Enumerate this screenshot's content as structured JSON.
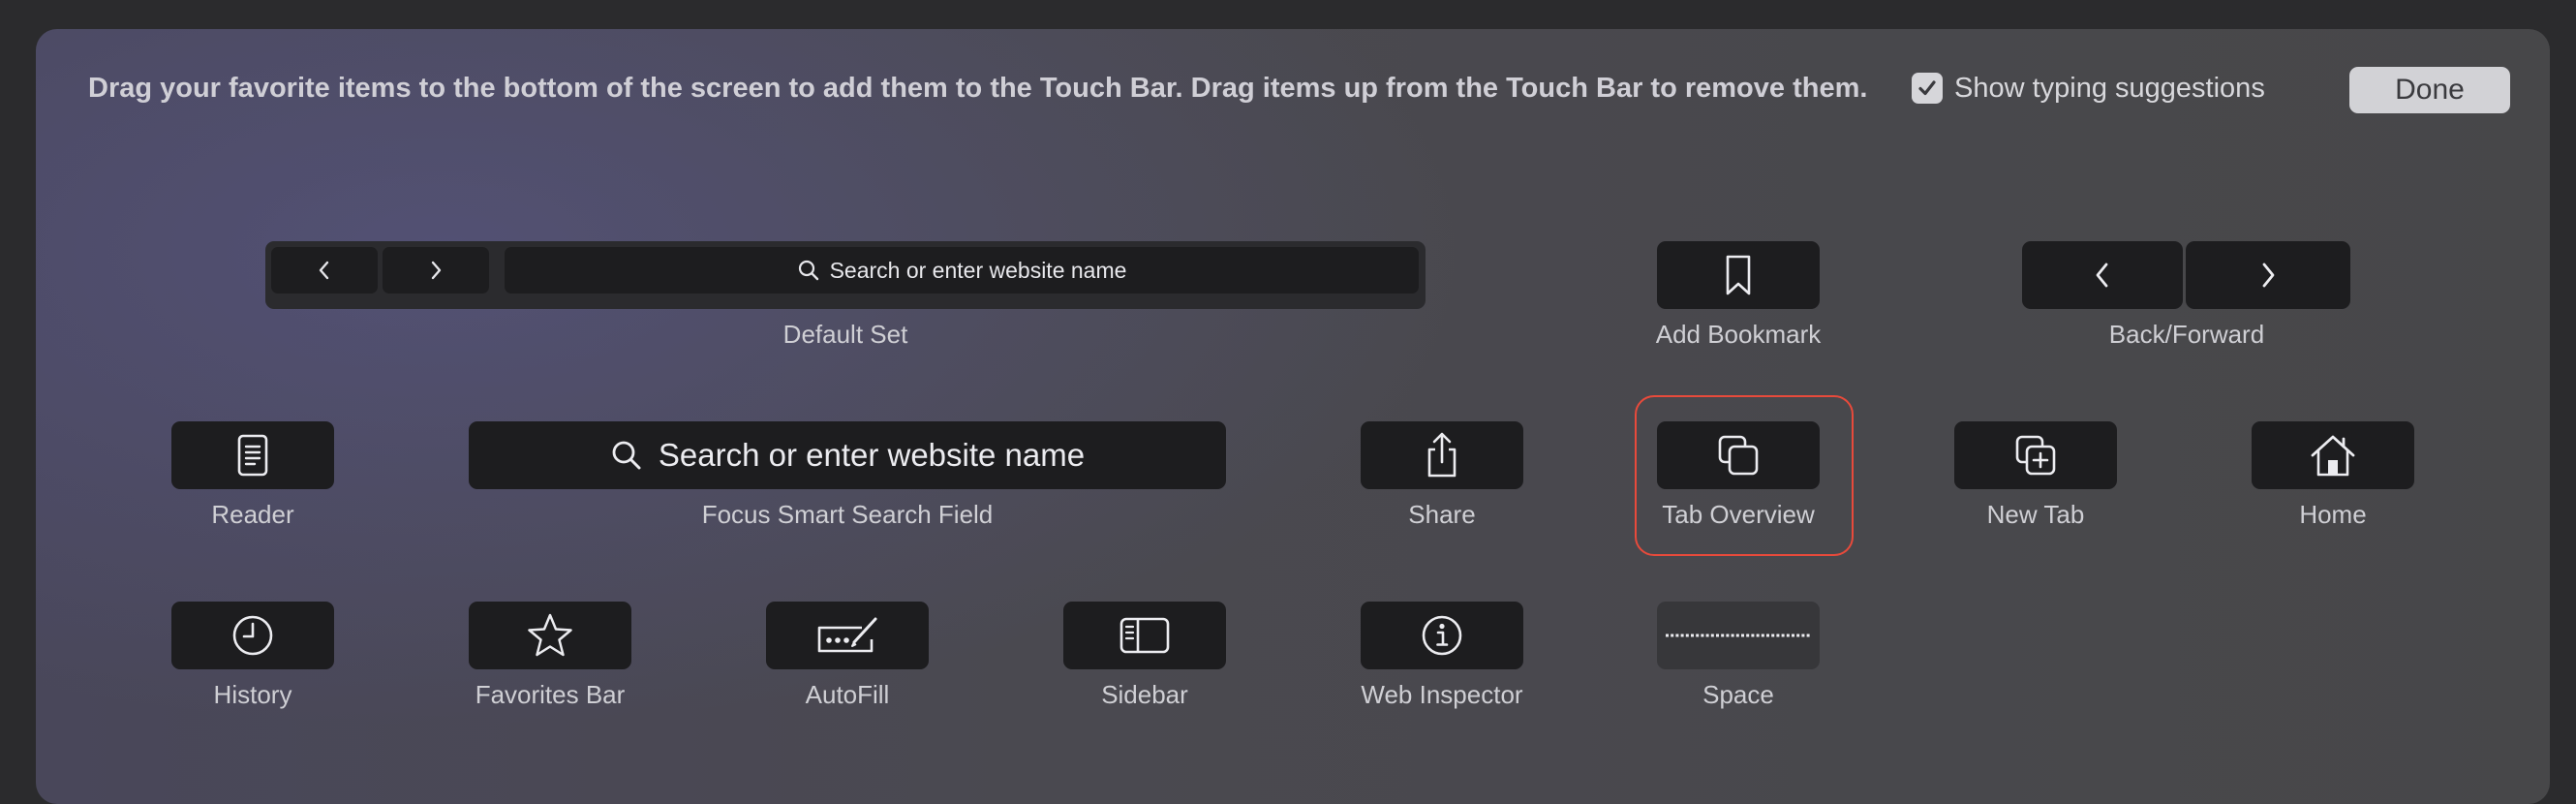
{
  "instructions": "Drag your favorite items to the bottom of the screen to add them to the Touch Bar. Drag items up from the Touch Bar to remove them.",
  "typing_suggestions": {
    "label": "Show typing suggestions",
    "checked": true
  },
  "done_label": "Done",
  "default_set": {
    "label": "Default Set",
    "search_placeholder": "Search or enter website name"
  },
  "items": {
    "add_bookmark": {
      "label": "Add Bookmark",
      "icon": "bookmark-icon"
    },
    "back_forward": {
      "label": "Back/Forward",
      "icon": "chevron-icon"
    },
    "reader": {
      "label": "Reader",
      "icon": "reader-icon"
    },
    "focus_search": {
      "label": "Focus Smart Search Field",
      "search_text": "Search or enter website name",
      "icon": "search-icon"
    },
    "share": {
      "label": "Share",
      "icon": "share-icon"
    },
    "tab_overview": {
      "label": "Tab Overview",
      "icon": "tab-overview-icon",
      "selected": true
    },
    "new_tab": {
      "label": "New Tab",
      "icon": "new-tab-icon"
    },
    "home": {
      "label": "Home",
      "icon": "home-icon"
    },
    "history": {
      "label": "History",
      "icon": "clock-icon"
    },
    "favorites_bar": {
      "label": "Favorites Bar",
      "icon": "star-icon"
    },
    "autofill": {
      "label": "AutoFill",
      "icon": "autofill-icon"
    },
    "sidebar": {
      "label": "Sidebar",
      "icon": "sidebar-icon"
    },
    "web_inspector": {
      "label": "Web Inspector",
      "icon": "info-icon"
    },
    "space": {
      "label": "Space",
      "icon": "space-icon"
    }
  },
  "colors": {
    "highlight": "#e84a3b",
    "key_background": "#1d1d1f",
    "done_button": "#d2d2d6"
  }
}
